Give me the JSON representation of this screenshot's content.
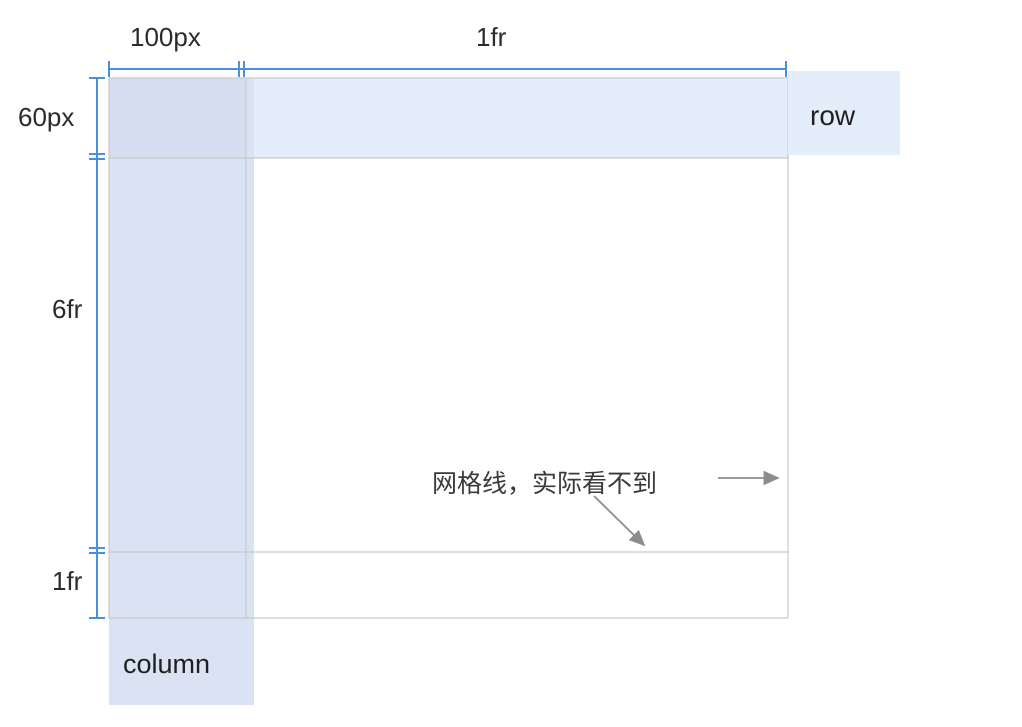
{
  "dimensions": {
    "columns": [
      "100px",
      "1fr"
    ],
    "rows": [
      "60px",
      "6fr",
      "1fr"
    ]
  },
  "tags": {
    "row": "row",
    "column": "column"
  },
  "annotation": "网格线，实际看不到",
  "colors": {
    "row_highlight": "#e4eefa",
    "column_highlight": "#d9e3f3",
    "dimension_line": "#4a90d9",
    "grid_line": "#c9c9c9",
    "arrow": "#8c8c8c"
  }
}
